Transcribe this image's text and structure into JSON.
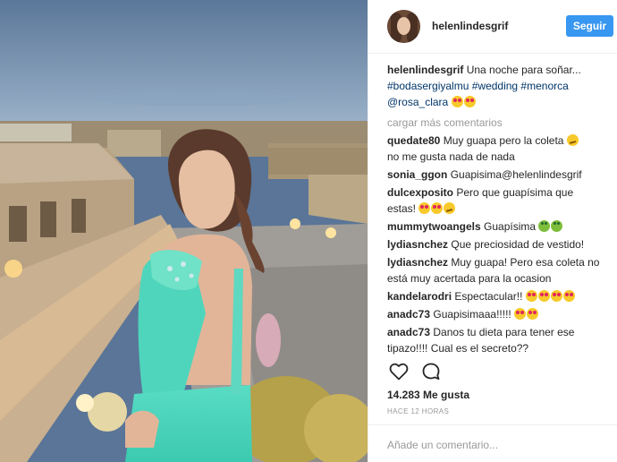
{
  "post": {
    "username": "helenlindesgrif",
    "follow_label": "Seguir",
    "caption": {
      "user": "helenlindesgrif",
      "text": "Una noche para soñar...",
      "tags": "#bodasergiyalmu #wedding #menorca",
      "mention": "@rosa_clara"
    },
    "load_more": "cargar más comentarios",
    "comments": [
      {
        "user": "quedate80",
        "text": "Muy guapa pero la coleta",
        "text2": "no me gusta nada de nada",
        "emoji": [
          "smirk"
        ]
      },
      {
        "user": "sonia_ggon",
        "text": "Guapisima@helenlindesgrif",
        "emoji": []
      },
      {
        "user": "dulcexposito",
        "text": "Pero que guapísima que",
        "text2": "estas!",
        "emoji": [
          "heart",
          "heart",
          "smirk"
        ]
      },
      {
        "user": "mummytwoangels",
        "text": "Guapísima",
        "emoji": [
          "frog",
          "frog"
        ]
      },
      {
        "user": "lydiasnchez",
        "text": "Que preciosidad de vestido!",
        "emoji": []
      },
      {
        "user": "lydiasnchez",
        "text": "Muy guapa! Pero esa coleta no",
        "text2": "está muy acertada para la ocasion",
        "emoji": []
      },
      {
        "user": "kandelarodri",
        "text": "Espectacular!!",
        "emoji": [
          "heart",
          "heart",
          "heart",
          "heart"
        ]
      },
      {
        "user": "anadc73",
        "text": "Guapisimaaa!!!!!",
        "emoji": [
          "heart",
          "heart"
        ]
      },
      {
        "user": "anadc73",
        "text": "Danos tu dieta para tener ese",
        "text2": "tipazo!!!! Cual es el secreto??",
        "emoji": []
      }
    ],
    "likes": "14.283 Me gusta",
    "time": "HACE 12 HORAS",
    "comment_placeholder": "Añade un comentario...",
    "icons": [
      "heart-icon",
      "comment-icon"
    ]
  },
  "colors": {
    "accent": "#3897f0",
    "text": "#262626",
    "muted": "#999999",
    "link": "#003569"
  }
}
